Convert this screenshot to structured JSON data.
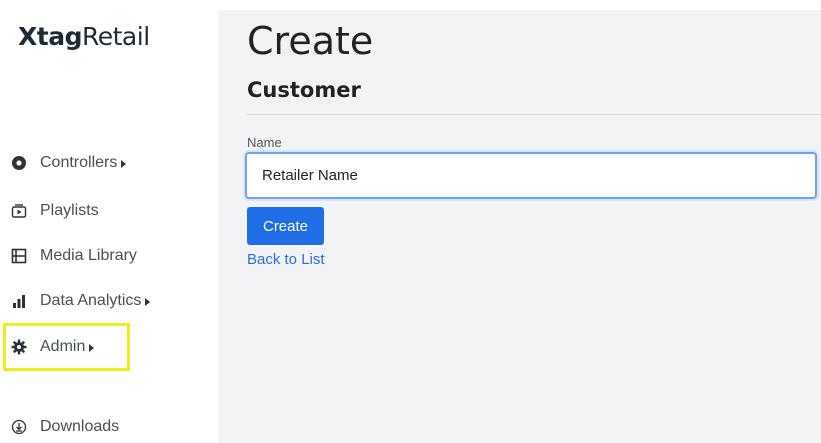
{
  "brand": {
    "bold": "Xtag",
    "light": "Retail"
  },
  "sidebar": {
    "items": [
      {
        "label": "Controllers",
        "icon": "circle-dot-icon",
        "has_caret": true
      },
      {
        "label": "Playlists",
        "icon": "playlist-play-icon",
        "has_caret": false
      },
      {
        "label": "Media Library",
        "icon": "media-library-icon",
        "has_caret": false
      },
      {
        "label": "Data Analytics",
        "icon": "bar-chart-icon",
        "has_caret": true
      },
      {
        "label": "Admin",
        "icon": "gear-icon",
        "has_caret": true,
        "highlighted": true
      },
      {
        "label": "Downloads",
        "icon": "download-icon",
        "has_caret": false
      }
    ]
  },
  "main": {
    "title": "Create",
    "subtitle": "Customer",
    "form": {
      "name_label": "Name",
      "name_value": "Retailer Name"
    },
    "create_button": "Create",
    "back_link": "Back to List"
  },
  "colors": {
    "highlight": "#f1ec1a",
    "primary": "#1f6ee8",
    "link": "#2c6fd4",
    "main_bg": "#f2f3f5"
  }
}
